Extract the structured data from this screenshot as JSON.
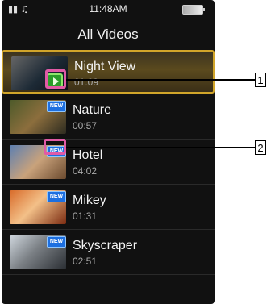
{
  "status": {
    "left": "▮▮ ♫",
    "time": "11:48AM"
  },
  "title": "All Videos",
  "videos": [
    {
      "name": "Night View",
      "duration": "01:09",
      "selected": true,
      "badge": ""
    },
    {
      "name": "Nature",
      "duration": "00:57",
      "selected": false,
      "badge": "NEW"
    },
    {
      "name": "Hotel",
      "duration": "04:02",
      "selected": false,
      "badge": "NEW"
    },
    {
      "name": "Mikey",
      "duration": "01:31",
      "selected": false,
      "badge": "NEW"
    },
    {
      "name": "Skyscraper",
      "duration": "02:51",
      "selected": false,
      "badge": "NEW"
    }
  ],
  "callouts": [
    "1",
    "2"
  ],
  "colors": {
    "selected_border": "#d1a52a",
    "callout": "#e05aa6"
  }
}
